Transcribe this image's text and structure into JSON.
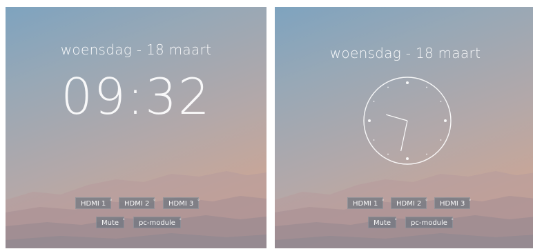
{
  "left_panel": {
    "date": "woensdag - 18 maart",
    "time": "09:32",
    "inputs": [
      "HDMI 1",
      "HDMI 2",
      "HDMI 3"
    ],
    "controls": [
      "Mute",
      "pc-module"
    ]
  },
  "right_panel": {
    "date": "woensdag - 18 maart",
    "clock": {
      "hour": 9,
      "minute": 32
    },
    "inputs": [
      "HDMI 1",
      "HDMI 2",
      "HDMI 3"
    ],
    "controls": [
      "Mute",
      "pc-module"
    ]
  },
  "colors": {
    "sky_top": "#7ea3bf",
    "sky_bottom": "#d2a58e",
    "button_bg": "#6e7680",
    "text": "#ffffff"
  }
}
